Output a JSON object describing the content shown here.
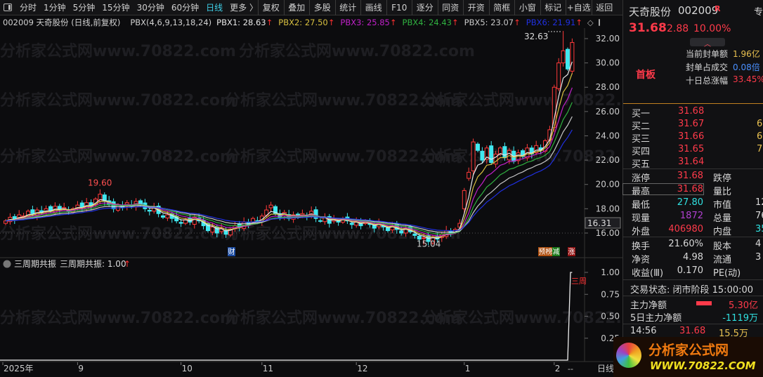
{
  "toolbar": {
    "periods": [
      "分时",
      "1分钟",
      "5分钟",
      "15分钟",
      "30分钟",
      "60分钟",
      "日线",
      "更多 〉"
    ],
    "active_period": "日线",
    "buttons": [
      "复权",
      "叠加",
      "多股",
      "统计",
      "画线",
      "F10",
      "逐分",
      "同资",
      "开资",
      "简框",
      "小窗",
      "标记",
      "+自选",
      "返回"
    ]
  },
  "info": {
    "title": "002009 天奇股份 (日线,前复权)",
    "indicator": "PBX(4,6,9,13,18,24)",
    "lines": [
      {
        "label": "PBX1: 28.63",
        "color": "#e8e8e8"
      },
      {
        "label": "PBX2: 27.50",
        "color": "#d8c040"
      },
      {
        "label": "PBX3: 25.85",
        "color": "#c020c8"
      },
      {
        "label": "PBX4: 24.43",
        "color": "#30b040"
      },
      {
        "label": "PBX5: 23.07",
        "color": "#c8c8c8"
      },
      {
        "label": "PBX6: 21.91",
        "color": "#2030e0"
      }
    ],
    "arrow": "↑"
  },
  "sub_info": {
    "name": "三周期共振",
    "value_label": "三周期共振: 1.00",
    "arrow": "↑",
    "tag": "三周"
  },
  "chart_data": {
    "type": "candlestick",
    "price_ticks": [
      32,
      30,
      28,
      26,
      24,
      22,
      20,
      18,
      16
    ],
    "ylim": [
      15.2,
      33.2
    ],
    "sub_ticks": [
      1.0,
      0.75,
      0.5,
      0.25
    ],
    "x_labels": [
      {
        "label": "2025年",
        "bar": 0
      },
      {
        "label": "9",
        "bar": 16
      },
      {
        "label": "10",
        "bar": 39
      },
      {
        "label": "11",
        "bar": 57
      },
      {
        "label": "12",
        "bar": 78
      },
      {
        "label": "1",
        "bar": 102
      },
      {
        "label": "2",
        "bar": 122
      }
    ],
    "closes": [
      17.0,
      17.3,
      17.1,
      17.5,
      17.4,
      17.8,
      17.6,
      17.9,
      17.7,
      18.0,
      17.8,
      18.2,
      17.9,
      18.1,
      17.8,
      18.0,
      18.3,
      18.1,
      18.5,
      18.2,
      18.8,
      19.2,
      18.6,
      18.4,
      18.0,
      18.3,
      18.1,
      18.5,
      18.2,
      18.6,
      18.3,
      18.0,
      17.8,
      18.1,
      17.6,
      17.3,
      17.5,
      17.2,
      17.0,
      16.8,
      17.1,
      16.9,
      17.3,
      17.0,
      16.6,
      16.2,
      16.5,
      16.0,
      16.4,
      15.9,
      16.3,
      16.6,
      16.5,
      16.9,
      16.7,
      17.2,
      17.0,
      17.4,
      17.9,
      18.3,
      17.6,
      17.3,
      17.7,
      17.2,
      17.5,
      17.3,
      17.6,
      17.4,
      17.8,
      17.2,
      17.0,
      17.3,
      16.8,
      17.1,
      16.9,
      17.2,
      17.0,
      16.7,
      16.9,
      16.6,
      17.0,
      16.7,
      16.4,
      16.8,
      16.5,
      16.2,
      16.6,
      16.3,
      16.0,
      16.4,
      16.1,
      15.8,
      15.5,
      15.6,
      15.3,
      15.7,
      15.5,
      15.9,
      16.2,
      16.0,
      16.3,
      16.8,
      19.5,
      21.0,
      23.5,
      22.8,
      22.0,
      23.0,
      21.8,
      22.5,
      23.0,
      22.2,
      22.8,
      21.9,
      22.6,
      22.3,
      23.0,
      22.5,
      23.2,
      22.8,
      23.6,
      24.5,
      28.0,
      30.0,
      31.0,
      29.5,
      31.68
    ],
    "ma_periods": [
      4,
      6,
      9,
      13,
      18,
      24
    ],
    "annotations": {
      "high": "32.63",
      "mid_high": "19.60",
      "low": "15.04",
      "cursor_price": "16.31"
    },
    "signal_values": {
      "before": 0,
      "last_bars": 1.0
    },
    "event_tags": [
      {
        "text": "财",
        "color": "#1a4aa0"
      },
      {
        "text": "预",
        "color": "#b05010"
      },
      {
        "text": "榜",
        "color": "#b05010"
      },
      {
        "text": "减",
        "color": "#1a7a1a"
      },
      {
        "text": "涨",
        "color": "#901010"
      }
    ],
    "axis_end": "--",
    "period_label": "日线"
  },
  "watermark": "分析家公式网www.70822.com",
  "panel": {
    "name": "天奇股份",
    "code": "002009",
    "r": "R",
    "zhuan": "专",
    "price": "31.68",
    "change": "2.88",
    "pct": "10.00%",
    "seal": [
      {
        "k": "当前封单额",
        "v": "1.96亿",
        "c": "yel"
      },
      {
        "k": "封单占成交",
        "v": "0.08倍",
        "c": "blu"
      },
      {
        "k": "十日总涨幅",
        "v": "33.45%",
        "c": "red"
      }
    ],
    "board": "首板",
    "bids": [
      {
        "k": "买一",
        "p": "31.68",
        "v": ""
      },
      {
        "k": "买二",
        "p": "31.67",
        "v": "6"
      },
      {
        "k": "买三",
        "p": "31.66",
        "v": "6"
      },
      {
        "k": "买四",
        "p": "31.65",
        "v": "7"
      },
      {
        "k": "买五",
        "p": "31.64",
        "v": ""
      }
    ],
    "stats1": [
      {
        "k": "涨停",
        "v": "31.68",
        "c": "red",
        "k2": "跌停",
        "v2": "",
        "c2": "wh"
      },
      {
        "k": "最高",
        "v": "31.68",
        "c": "red",
        "k2": "量比",
        "v2": "",
        "c2": "wh"
      },
      {
        "k": "最低",
        "v": "27.80",
        "c": "cyan",
        "k2": "市值",
        "v2": "12",
        "c2": "wh"
      },
      {
        "k": "现量",
        "v": "1872",
        "c": "pur",
        "k2": "总量",
        "v2": "76",
        "c2": "wh"
      },
      {
        "k": "外盘",
        "v": "406980",
        "c": "red",
        "k2": "内盘",
        "v2": "35",
        "c2": "cyan"
      }
    ],
    "stats2": [
      {
        "k": "换手",
        "v": "21.60%",
        "k2": "股本",
        "v2": "4"
      },
      {
        "k": "净资",
        "v": "4.98",
        "k2": "流通",
        "v2": "3"
      },
      {
        "k": "收益(Ⅲ)",
        "v": "0.170",
        "k2": "PE(动)",
        "v2": ""
      }
    ],
    "status": "交易状态: 闭市阶段 15:00:00",
    "flow": [
      {
        "k": "主力净额",
        "v": "5.30亿",
        "c": "red"
      },
      {
        "k": "5日主力净额",
        "v": "-1119万",
        "c": "cyan"
      }
    ],
    "tick": {
      "time": "14:56",
      "price": "31.68",
      "vol": "15.5万"
    },
    "logo": {
      "title": "分析家公式网",
      "url": "WWW.70822.COM"
    }
  }
}
